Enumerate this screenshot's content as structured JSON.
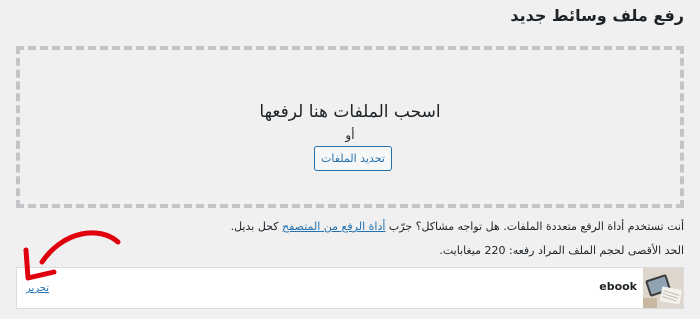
{
  "page": {
    "title": "رفع ملف وسائط جديد"
  },
  "uploader": {
    "drop_instructions": "اسحب الملفات هنا لرفعها",
    "or_text": "أو",
    "select_button": "تحديد الملفات",
    "note_prefix": "أنت تستخدم أداة الرفع متعددة الملفات. هل تواجه مشاكل؟ جرّب ",
    "note_link": "أداة الرفع من المتصفح",
    "note_suffix": " كحل بديل.",
    "max_size": "الحد الأقصى لحجم الملف المراد رفعه: 220 ميغابايت."
  },
  "media_item": {
    "filename": "ebook",
    "edit_label": "تحرير"
  },
  "colors": {
    "accent": "#2271b1",
    "annotation": "#e0000d"
  },
  "icons": {
    "annotation": "red-hand-drawn-arrow",
    "thumbnail": "ebook-thumbnail-image"
  }
}
